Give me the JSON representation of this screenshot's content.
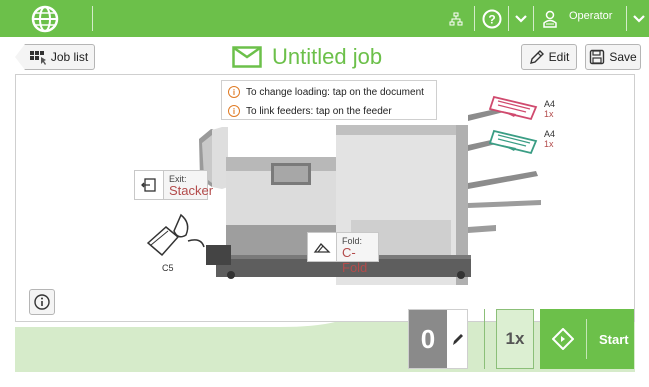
{
  "topbar": {
    "user_label": "Operator",
    "colors": {
      "accent": "#6cc04a"
    }
  },
  "header": {
    "job_list_label": "Job list",
    "title": "Untitled job",
    "edit_label": "Edit",
    "save_label": "Save"
  },
  "hints": {
    "loading": "To change loading: tap on the document",
    "feeders": "To link feeders: tap on the feeder"
  },
  "feeders": [
    {
      "format": "A4",
      "count": "1x"
    },
    {
      "format": "A4",
      "count": "1x"
    }
  ],
  "exit": {
    "label": "Exit:",
    "value": "Stacker"
  },
  "fold": {
    "label": "Fold:",
    "value": "C-Fold"
  },
  "envelope": {
    "label": "C5"
  },
  "footer": {
    "count": "0",
    "copies": "1x",
    "start_label": "Start"
  }
}
